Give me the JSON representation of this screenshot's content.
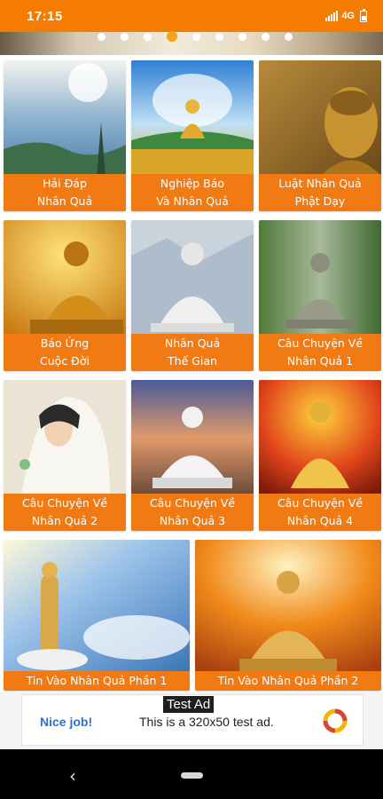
{
  "status_bar": {
    "time": "17:15",
    "network": "4G",
    "icons": [
      "signal-icon",
      "battery-icon"
    ],
    "bg_color": "#f47c00"
  },
  "banner": {
    "slide_count": 9,
    "active_slide": 4
  },
  "cards": [
    {
      "line1": "Hải Đáp",
      "line2": "Nhân Quả"
    },
    {
      "line1": "Nghiệp Báo",
      "line2": "Và Nhân Quả"
    },
    {
      "line1": "Luật Nhân Quả",
      "line2": "Phật Dạy"
    },
    {
      "line1": "Báo Ứng",
      "line2": "Cuộc Đời"
    },
    {
      "line1": "Nhân Quả",
      "line2": "Thế Gian"
    },
    {
      "line1": "Câu Chuyện Về",
      "line2": "Nhân Quả 1"
    },
    {
      "line1": "Câu Chuyện Về",
      "line2": "Nhân Quả 2"
    },
    {
      "line1": "Câu Chuyện Về",
      "line2": "Nhân Quả 3"
    },
    {
      "line1": "Câu Chuyện Về",
      "line2": "Nhân Quả 4"
    },
    {
      "line1": "Tin Vào Nhân Quả Phần 1",
      "line2": ""
    },
    {
      "line1": "Tin Vào Nhân Quả Phần 2",
      "line2": ""
    }
  ],
  "caption_color": "#f27a13",
  "ad": {
    "label": "Test Ad",
    "nice": "Nice job!",
    "text": "This is a 320x50 test ad."
  },
  "nav": {
    "back": "‹"
  }
}
